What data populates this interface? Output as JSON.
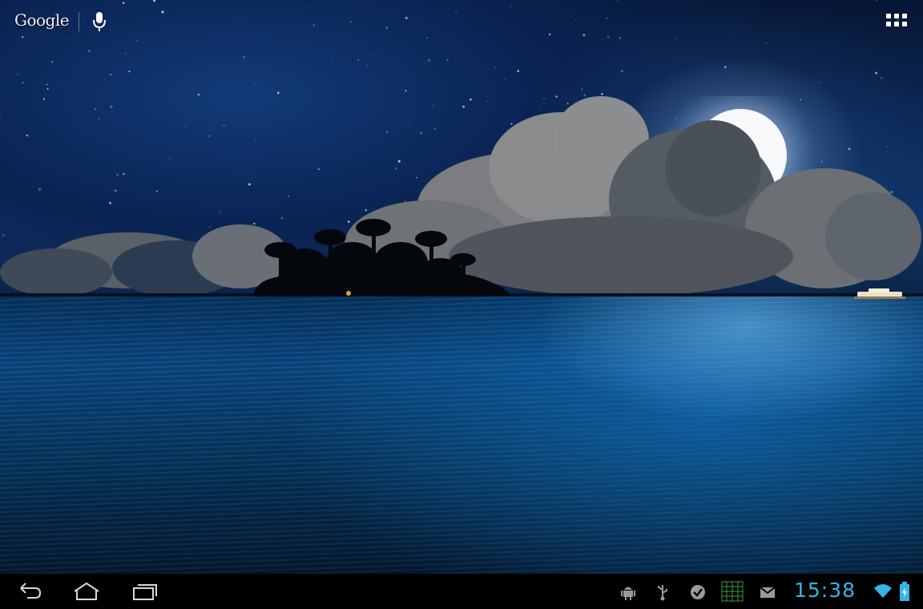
{
  "launcher": {
    "search_label": "Google"
  },
  "system_bar": {
    "time": "15:38",
    "status_icons": [
      "android-debug-icon",
      "usb-icon",
      "check-icon",
      "grid-widget-icon",
      "gmail-icon",
      "wifi-icon",
      "battery-icon"
    ]
  },
  "colors": {
    "clock": "#33b5e5",
    "bar": "#000000"
  }
}
